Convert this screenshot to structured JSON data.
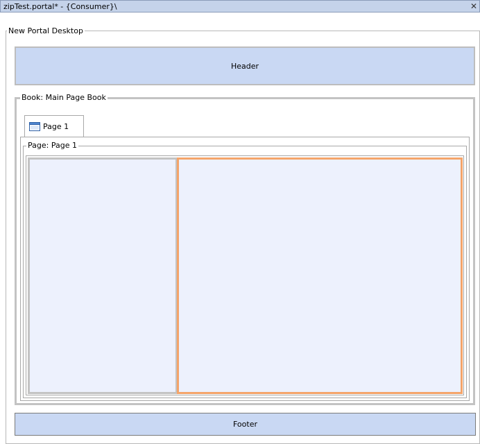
{
  "window": {
    "title": "zipTest.portal* - {Consumer}\\",
    "close_label": "✕"
  },
  "desktop": {
    "label": "New Portal Desktop"
  },
  "header": {
    "label": "Header"
  },
  "book": {
    "label": "Book: Main Page Book"
  },
  "tabs": [
    {
      "label": "Page 1",
      "icon": "page-icon"
    }
  ],
  "page": {
    "label": "Page: Page 1"
  },
  "footer": {
    "label": "Footer"
  },
  "colors": {
    "region_fill": "#c9d8f3",
    "column_fill": "#edf1fd",
    "selected_border": "#f4a46a"
  }
}
